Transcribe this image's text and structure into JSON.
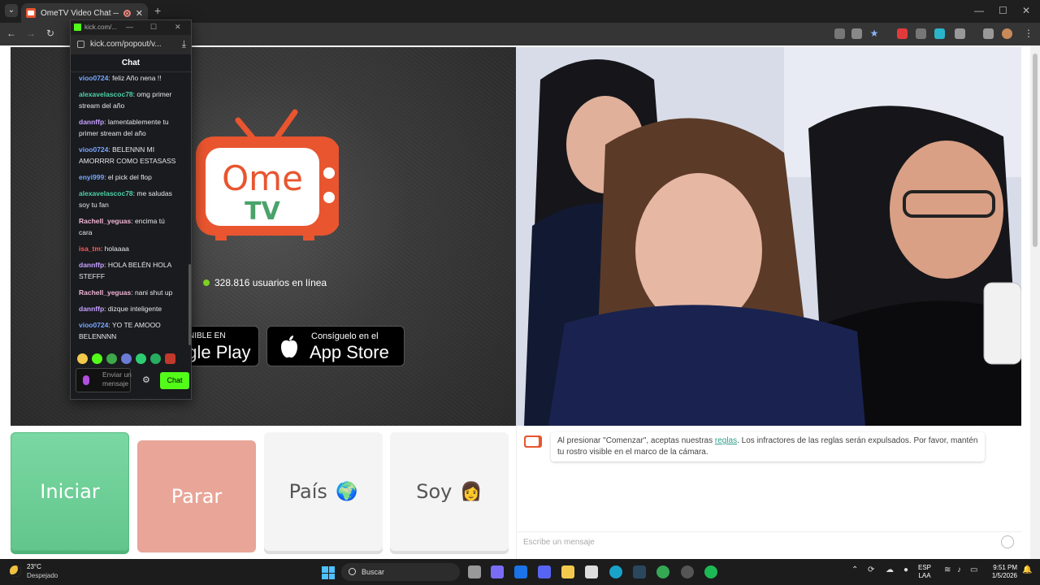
{
  "browser": {
    "tab_title": "OmeTV Video Chat — Ome",
    "tab_close": "✕",
    "new_tab": "+",
    "window_controls": [
      "—",
      "☐",
      "✕"
    ]
  },
  "popout": {
    "title": "kick.com/...",
    "controls": [
      "—",
      "☐",
      "✕"
    ],
    "url": "kick.com/popout/v...",
    "chat_heading": "Chat",
    "messages": [
      {
        "user": "vioo0724",
        "text": ": feliz Año nena !!",
        "color": "#7aa7ff"
      },
      {
        "user": "alexavelascoc78",
        "text": ": omg primer stream del año",
        "color": "#4fd1a5"
      },
      {
        "user": "dannffp",
        "text": ": lamentablemente tu primer stream del año",
        "color": "#c6a0ff"
      },
      {
        "user": "vioo0724",
        "text": ": BELENNN MI AMORRRR COMO ESTASASS",
        "color": "#7aa7ff"
      },
      {
        "user": "enyi999",
        "text": ": el pick del flop",
        "color": "#7aa7ff"
      },
      {
        "user": "alexavelascoc78",
        "text": ": me saludas soy tu fan",
        "color": "#4fd1a5"
      },
      {
        "user": "Rachell_yeguas",
        "text": ": encima tú cara",
        "color": "#f0b4d4"
      },
      {
        "user": "isa_tm",
        "text": ": holaaaa",
        "color": "#ff5a5a"
      },
      {
        "user": "dannffp",
        "text": ": HOLA BELÉN HOLA STEFFF",
        "color": "#c6a0ff"
      },
      {
        "user": "Rachell_yeguas",
        "text": ": nani shut up",
        "color": "#f0b4d4"
      },
      {
        "user": "dannffp",
        "text": ": dizque inteligente",
        "color": "#c6a0ff"
      },
      {
        "user": "vioo0724",
        "text": ": YO TE AMOOO BELENNNN",
        "color": "#7aa7ff"
      }
    ],
    "input_placeholder": "Enviar un mensaje",
    "send_label": "Chat",
    "settings_icon": "gear-icon",
    "accent": "#53fc18"
  },
  "page": {
    "logo_top": "Ome",
    "logo_bottom": "TV",
    "online_text": "328.816 usuarios en línea",
    "google_small": "NIBLE EN",
    "google_big": "ogle Play",
    "apple_small": "Consíguelo en el",
    "apple_big": "App Store",
    "btn_start": "Iniciar",
    "btn_stop": "Parar",
    "btn_country": "País",
    "btn_country_emoji": "🌍",
    "btn_gender": "Soy",
    "btn_gender_emoji": "👩",
    "notice_pre": "Al presionar \"Comenzar\", aceptas nuestras ",
    "notice_link": "reglas",
    "notice_post": ". Los infractores de las reglas serán expulsados. Por favor, mantén tu rostro visible en el marco de la cámara.",
    "chat_placeholder": "Escribe un mensaje",
    "brand_color": "#e8552f"
  },
  "taskbar": {
    "temp": "23°C",
    "condition": "Despejado",
    "search": "Buscar",
    "lang_top": "ESP",
    "lang_bottom": "LAA",
    "time": "9:51 PM",
    "date": "1/5/2026"
  }
}
